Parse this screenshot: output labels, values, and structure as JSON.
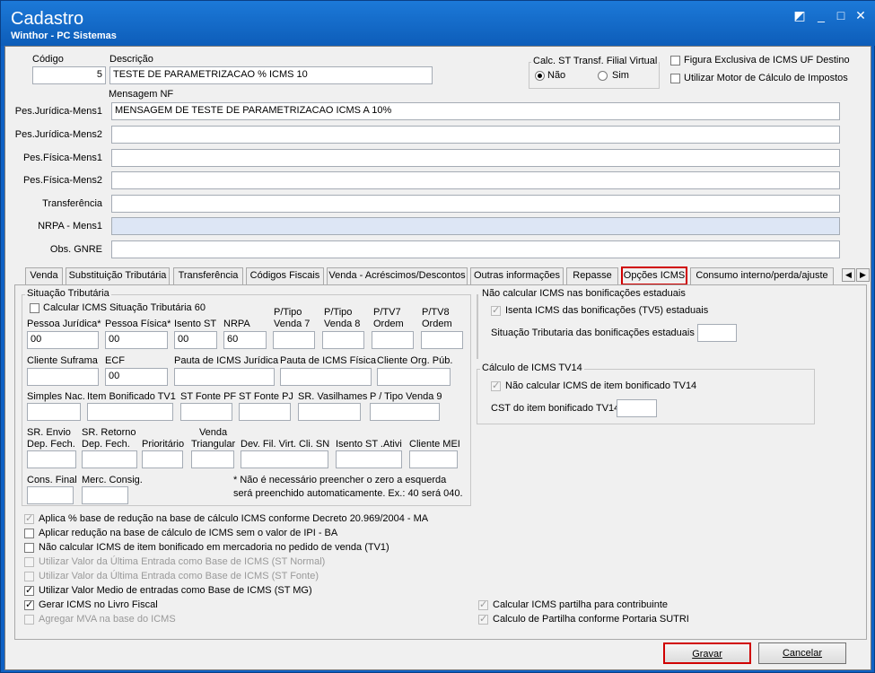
{
  "window": {
    "title": "Cadastro",
    "subtitle": "Winthor - PC Sistemas"
  },
  "header": {
    "codigo_label": "Código",
    "codigo_value": "5",
    "descricao_label": "Descrição",
    "descricao_value": "TESTE DE PARAMETRIZACAO % ICMS 10",
    "calc_st_title": "Calc. ST Transf. Filial Virtual",
    "nao_label": "Não",
    "sim_label": "Sim",
    "figura_label": "Figura Exclusiva de ICMS UF Destino",
    "motor_label": "Utilizar Motor de Cálculo de Impostos",
    "mensagem_label": "Mensagem NF"
  },
  "messages": [
    {
      "label": "Pes.Jurídica-Mens1",
      "value": "MENSAGEM DE TESTE DE PARAMETRIZACAO ICMS A 10%"
    },
    {
      "label": "Pes.Jurídica-Mens2",
      "value": ""
    },
    {
      "label": "Pes.Física-Mens1",
      "value": ""
    },
    {
      "label": "Pes.Física-Mens2",
      "value": ""
    },
    {
      "label": "Transferência",
      "value": ""
    },
    {
      "label": "NRPA - Mens1",
      "value": ""
    },
    {
      "label": "Obs. GNRE",
      "value": ""
    }
  ],
  "tabs": [
    "Venda",
    "Substituição Tributária",
    "Transferência",
    "Códigos Fiscais",
    "Venda - Acréscimos/Descontos",
    "Outras informações",
    "Repasse",
    "Opções ICMS",
    "Consumo interno/perda/ajuste"
  ],
  "sit": {
    "title": "Situação Tributária",
    "calc60": "Calcular ICMS Situação Tributária 60",
    "pj": "Pessoa Jurídica*",
    "pj_v": "00",
    "pf": "Pessoa Física*",
    "pf_v": "00",
    "isento": "Isento ST",
    "isento_v": "00",
    "nrpa": "NRPA",
    "nrpa_v": "60",
    "ptv7": "P/Tipo\nVenda 7",
    "ptv8": "P/Tipo\nVenda 8",
    "ptv7o": "P/TV7\nOrdem",
    "ptv8o": "P/TV8\nOrdem",
    "suframa": "Cliente Suframa",
    "ecf": "ECF",
    "ecf_v": "00",
    "pauta_j": "Pauta de ICMS Jurídica",
    "pauta_f": "Pauta de ICMS Física",
    "orgpub": "Cliente Org. Púb.",
    "simples": "Simples Nac.",
    "itbon": "Item Bonificado TV1",
    "stpf": "ST Fonte PF",
    "stpj": "ST Fonte PJ",
    "srvas": "SR. Vasilhames",
    "ptv9": "P / Tipo Venda 9",
    "srenv": "SR. Envio\nDep. Fech.",
    "srret": "SR. Retorno\nDep. Fech.",
    "prior": "Prioritário",
    "vtri": "Venda\nTriangular",
    "devfil": "Dev. Fil. Virt. Cli. SN",
    "isativ": "Isento ST .Ativi",
    "mei": "Cliente MEI",
    "consf": "Cons. Final",
    "mercc": "Merc. Consig.",
    "note1": "* Não é necessário preencher o zero a esquerda",
    "note2": "será preenchido automaticamente.  Ex.: 40 será 040."
  },
  "bonif": {
    "title": "Não calcular ICMS nas bonificações estaduais",
    "isenta": "Isenta ICMS das bonificações (TV5) estaduais",
    "sit": "Situação Tributaria das  bonificações estaduais"
  },
  "tv14": {
    "title": "Cálculo de ICMS TV14",
    "naocalc": "Não calcular ICMS de item bonificado TV14",
    "cst": "CST do item bonificado TV14"
  },
  "options": [
    {
      "label": "Aplica % base de redução na base de cálculo ICMS conforme Decreto 20.969/2004 - MA",
      "checked": true,
      "disabled": true
    },
    {
      "label": "Aplicar redução na base de cálculo de ICMS sem o valor de IPI - BA",
      "checked": false,
      "disabled": false
    },
    {
      "label": "Não calcular ICMS de item bonificado em mercadoria no pedido de venda (TV1)",
      "checked": false,
      "disabled": false
    },
    {
      "label": "Utilizar Valor da Última Entrada como Base de ICMS (ST Normal)",
      "checked": false,
      "disabled": true
    },
    {
      "label": "Utilizar Valor da Última Entrada como Base de ICMS (ST Fonte)",
      "checked": false,
      "disabled": true
    },
    {
      "label": "Utilizar Valor Medio de entradas como Base de ICMS (ST MG)",
      "checked": true,
      "disabled": false
    },
    {
      "label": "Gerar ICMS no Livro Fiscal",
      "checked": true,
      "disabled": false
    },
    {
      "label": "Agregar MVA na base do ICMS",
      "checked": false,
      "disabled": true
    }
  ],
  "right_options": [
    {
      "label": "Calcular ICMS partilha para contribuinte",
      "checked": true
    },
    {
      "label": "Calculo de Partilha conforme Portaria SUTRI",
      "checked": true
    }
  ],
  "buttons": {
    "gravar": "Gravar",
    "cancelar": "Cancelar"
  },
  "colors": {
    "title_bar": "#0d5db9",
    "highlight": "#d00000",
    "nrpa_bg": "#dde6f5"
  }
}
